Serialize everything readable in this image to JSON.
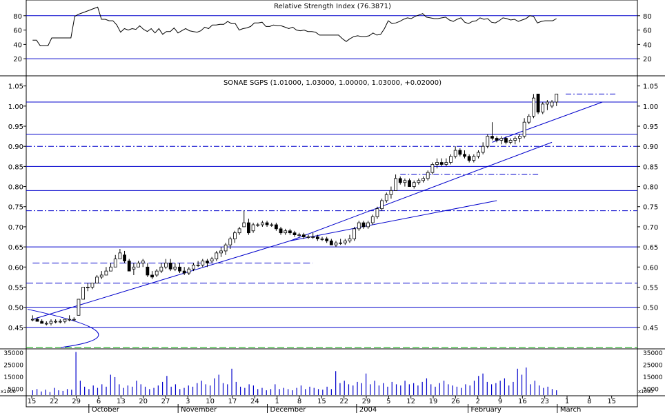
{
  "chart_data": [
    {
      "type": "line",
      "title": "Relative Strength Index (76.3871)",
      "ylim": [
        0,
        100
      ],
      "y_ticks": [
        "80",
        "60",
        "40",
        "20"
      ],
      "y_tick_values": [
        80,
        60,
        40,
        20
      ],
      "reference_lines": [
        80,
        20
      ],
      "series": [
        {
          "values": [
            46,
            46,
            38,
            38,
            38,
            49,
            49,
            49,
            49,
            49,
            49,
            79,
            82,
            84,
            86,
            88,
            90,
            92,
            75,
            75,
            73,
            73,
            67,
            57,
            62,
            60,
            62,
            61,
            66,
            61,
            58,
            62,
            56,
            62,
            54,
            58,
            58,
            63,
            56,
            59,
            62,
            59,
            58,
            57,
            59,
            64,
            62,
            67,
            67,
            68,
            68,
            72,
            69,
            69,
            60,
            62,
            63,
            65,
            70,
            70,
            71,
            65,
            65,
            67,
            66,
            66,
            64,
            62,
            64,
            60,
            59,
            60,
            58,
            58,
            57,
            53,
            53,
            53,
            53,
            53,
            53,
            48,
            44,
            48,
            51,
            52,
            51,
            51,
            52,
            56,
            53,
            54,
            62,
            73,
            69,
            70,
            72,
            75,
            77,
            76,
            79,
            81,
            83,
            78,
            77,
            76,
            76,
            77,
            78,
            74,
            72,
            75,
            77,
            71,
            69,
            72,
            73,
            77,
            75,
            76,
            71,
            70,
            73,
            77,
            76,
            74,
            75,
            72,
            74,
            76,
            80,
            79,
            70,
            72,
            73,
            73,
            73,
            76
          ]
        }
      ]
    },
    {
      "type": "line",
      "title": "SONAE SGPS (1.01000, 1.03000, 1.00000, 1.03000, +0.02000)",
      "ylim": [
        0.4,
        1.07
      ],
      "y_ticks": [
        "1.05",
        "1.00",
        "0.95",
        "0.90",
        "0.85",
        "0.80",
        "0.75",
        "0.70",
        "0.65",
        "0.60",
        "0.55",
        "0.50",
        "0.45"
      ],
      "y_tick_values": [
        1.05,
        1.0,
        0.95,
        0.9,
        0.85,
        0.8,
        0.75,
        0.7,
        0.65,
        0.6,
        0.55,
        0.5,
        0.45
      ],
      "horizontal_levels_solid": [
        1.01,
        0.93,
        0.85,
        0.79,
        0.65,
        0.5,
        0.45
      ],
      "horizontal_levels_dashdot": [
        0.9,
        0.74
      ],
      "horizontal_levels_dashed": [
        0.56
      ],
      "green_level": 0.4,
      "x_ticks": [
        "15",
        "22",
        "29",
        "6",
        "13",
        "20",
        "27",
        "3",
        "10",
        "17",
        "24",
        "1",
        "8",
        "15",
        "22",
        "29",
        "5",
        "12",
        "19",
        "26",
        "2",
        "9",
        "16",
        "23",
        "1",
        "8",
        "15"
      ],
      "month_labels": [
        "October",
        "November",
        "December",
        "2004",
        "February",
        "March"
      ],
      "candles": [
        [
          0.47,
          0.48,
          0.465,
          0.47
        ],
        [
          0.47,
          0.475,
          0.465,
          0.465
        ],
        [
          0.465,
          0.47,
          0.46,
          0.46
        ],
        [
          0.46,
          0.465,
          0.455,
          0.46
        ],
        [
          0.46,
          0.47,
          0.455,
          0.465
        ],
        [
          0.465,
          0.47,
          0.46,
          0.465
        ],
        [
          0.465,
          0.47,
          0.46,
          0.465
        ],
        [
          0.465,
          0.47,
          0.46,
          0.47
        ],
        [
          0.47,
          0.48,
          0.465,
          0.47
        ],
        [
          0.47,
          0.475,
          0.465,
          0.47
        ],
        [
          0.48,
          0.52,
          0.48,
          0.52
        ],
        [
          0.52,
          0.55,
          0.52,
          0.55
        ],
        [
          0.55,
          0.56,
          0.54,
          0.55
        ],
        [
          0.55,
          0.56,
          0.545,
          0.56
        ],
        [
          0.56,
          0.58,
          0.56,
          0.575
        ],
        [
          0.575,
          0.59,
          0.57,
          0.58
        ],
        [
          0.58,
          0.6,
          0.58,
          0.59
        ],
        [
          0.59,
          0.61,
          0.59,
          0.6
        ],
        [
          0.6,
          0.63,
          0.6,
          0.62
        ],
        [
          0.62,
          0.645,
          0.62,
          0.635
        ],
        [
          0.63,
          0.64,
          0.61,
          0.615
        ],
        [
          0.615,
          0.62,
          0.59,
          0.59
        ],
        [
          0.595,
          0.61,
          0.58,
          0.6
        ],
        [
          0.6,
          0.615,
          0.6,
          0.61
        ],
        [
          0.61,
          0.62,
          0.6,
          0.615
        ],
        [
          0.6,
          0.61,
          0.575,
          0.58
        ],
        [
          0.58,
          0.59,
          0.57,
          0.575
        ],
        [
          0.58,
          0.595,
          0.575,
          0.59
        ],
        [
          0.59,
          0.61,
          0.585,
          0.6
        ],
        [
          0.6,
          0.62,
          0.595,
          0.61
        ],
        [
          0.61,
          0.62,
          0.59,
          0.595
        ],
        [
          0.595,
          0.61,
          0.59,
          0.6
        ],
        [
          0.6,
          0.61,
          0.585,
          0.59
        ],
        [
          0.59,
          0.6,
          0.58,
          0.585
        ],
        [
          0.585,
          0.6,
          0.58,
          0.595
        ],
        [
          0.595,
          0.61,
          0.59,
          0.605
        ],
        [
          0.605,
          0.615,
          0.6,
          0.605
        ],
        [
          0.605,
          0.62,
          0.6,
          0.615
        ],
        [
          0.615,
          0.62,
          0.6,
          0.61
        ],
        [
          0.615,
          0.625,
          0.61,
          0.62
        ],
        [
          0.62,
          0.64,
          0.615,
          0.635
        ],
        [
          0.635,
          0.65,
          0.625,
          0.64
        ],
        [
          0.64,
          0.66,
          0.63,
          0.655
        ],
        [
          0.655,
          0.675,
          0.645,
          0.67
        ],
        [
          0.67,
          0.69,
          0.66,
          0.685
        ],
        [
          0.685,
          0.7,
          0.68,
          0.695
        ],
        [
          0.7,
          0.74,
          0.7,
          0.71
        ],
        [
          0.71,
          0.72,
          0.68,
          0.685
        ],
        [
          0.69,
          0.71,
          0.685,
          0.705
        ],
        [
          0.705,
          0.71,
          0.7,
          0.705
        ],
        [
          0.705,
          0.715,
          0.7,
          0.71
        ],
        [
          0.71,
          0.715,
          0.7,
          0.705
        ],
        [
          0.705,
          0.71,
          0.7,
          0.705
        ],
        [
          0.705,
          0.71,
          0.69,
          0.695
        ],
        [
          0.695,
          0.7,
          0.68,
          0.685
        ],
        [
          0.685,
          0.695,
          0.68,
          0.69
        ],
        [
          0.69,
          0.695,
          0.68,
          0.685
        ],
        [
          0.685,
          0.69,
          0.675,
          0.68
        ],
        [
          0.68,
          0.685,
          0.675,
          0.68
        ],
        [
          0.68,
          0.685,
          0.67,
          0.675
        ],
        [
          0.675,
          0.68,
          0.67,
          0.675
        ],
        [
          0.675,
          0.685,
          0.67,
          0.675
        ],
        [
          0.675,
          0.68,
          0.665,
          0.67
        ],
        [
          0.67,
          0.675,
          0.665,
          0.67
        ],
        [
          0.67,
          0.675,
          0.66,
          0.665
        ],
        [
          0.665,
          0.67,
          0.655,
          0.655
        ],
        [
          0.655,
          0.665,
          0.65,
          0.66
        ],
        [
          0.66,
          0.67,
          0.655,
          0.66
        ],
        [
          0.66,
          0.67,
          0.655,
          0.665
        ],
        [
          0.665,
          0.68,
          0.66,
          0.67
        ],
        [
          0.67,
          0.7,
          0.665,
          0.695
        ],
        [
          0.695,
          0.715,
          0.69,
          0.71
        ],
        [
          0.71,
          0.715,
          0.695,
          0.7
        ],
        [
          0.7,
          0.715,
          0.695,
          0.71
        ],
        [
          0.71,
          0.73,
          0.705,
          0.725
        ],
        [
          0.725,
          0.75,
          0.72,
          0.745
        ],
        [
          0.745,
          0.77,
          0.74,
          0.765
        ],
        [
          0.765,
          0.785,
          0.76,
          0.78
        ],
        [
          0.78,
          0.8,
          0.77,
          0.79
        ],
        [
          0.79,
          0.83,
          0.79,
          0.82
        ],
        [
          0.82,
          0.825,
          0.805,
          0.81
        ],
        [
          0.81,
          0.82,
          0.8,
          0.815
        ],
        [
          0.815,
          0.82,
          0.8,
          0.8
        ],
        [
          0.8,
          0.815,
          0.795,
          0.81
        ],
        [
          0.81,
          0.82,
          0.805,
          0.815
        ],
        [
          0.815,
          0.825,
          0.81,
          0.82
        ],
        [
          0.82,
          0.84,
          0.815,
          0.835
        ],
        [
          0.835,
          0.86,
          0.83,
          0.855
        ],
        [
          0.855,
          0.87,
          0.845,
          0.86
        ],
        [
          0.86,
          0.87,
          0.85,
          0.855
        ],
        [
          0.855,
          0.87,
          0.85,
          0.86
        ],
        [
          0.86,
          0.88,
          0.855,
          0.875
        ],
        [
          0.875,
          0.9,
          0.87,
          0.89
        ],
        [
          0.89,
          0.895,
          0.875,
          0.88
        ],
        [
          0.88,
          0.89,
          0.87,
          0.875
        ],
        [
          0.875,
          0.88,
          0.86,
          0.865
        ],
        [
          0.865,
          0.88,
          0.86,
          0.875
        ],
        [
          0.875,
          0.89,
          0.87,
          0.885
        ],
        [
          0.885,
          0.91,
          0.88,
          0.9
        ],
        [
          0.9,
          0.93,
          0.895,
          0.925
        ],
        [
          0.925,
          0.96,
          0.915,
          0.92
        ],
        [
          0.92,
          0.925,
          0.91,
          0.915
        ],
        [
          0.915,
          0.925,
          0.905,
          0.92
        ],
        [
          0.92,
          0.925,
          0.905,
          0.91
        ],
        [
          0.91,
          0.92,
          0.905,
          0.915
        ],
        [
          0.915,
          0.925,
          0.905,
          0.92
        ],
        [
          0.92,
          0.93,
          0.91,
          0.925
        ],
        [
          0.925,
          0.97,
          0.92,
          0.96
        ],
        [
          0.96,
          0.98,
          0.955,
          0.975
        ],
        [
          0.975,
          1.03,
          0.97,
          1.02
        ],
        [
          1.03,
          1.03,
          0.98,
          0.985
        ],
        [
          0.985,
          1.01,
          0.98,
          1.005
        ],
        [
          1.005,
          1.015,
          0.99,
          1.01
        ],
        [
          1.0,
          1.015,
          0.995,
          1.01
        ],
        [
          1.01,
          1.03,
          1.0,
          1.03
        ]
      ],
      "candle_x_start": 0,
      "trendlines": [
        {
          "from": [
            0,
            0.47
          ],
          "to": [
            56,
            0.665
          ]
        },
        {
          "from": [
            56,
            0.665
          ],
          "to": [
            113,
            0.91
          ]
        },
        {
          "from": [
            56,
            0.665
          ],
          "to": [
            101,
            0.765
          ]
        },
        {
          "from": [
            100,
            0.91
          ],
          "to": [
            124,
            1.01
          ]
        }
      ],
      "short_levels": [
        {
          "y": 0.83,
          "from": 80,
          "to": 110,
          "style": "dashdot"
        },
        {
          "y": 1.03,
          "from": 116,
          "to": 127,
          "style": "dashdot"
        },
        {
          "y": 0.61,
          "from": 0,
          "to": 61,
          "style": "dashed"
        }
      ]
    },
    {
      "type": "bar",
      "ylim": [
        0,
        38000
      ],
      "y_ticks": [
        "35000",
        "25000",
        "15000",
        "5000"
      ],
      "y_tick_values": [
        35000,
        25000,
        15000,
        5000
      ],
      "unit_label": "x1000",
      "values": [
        4000,
        5000,
        3000,
        4500,
        2500,
        6000,
        4000,
        3500,
        5000,
        4500,
        36000,
        12000,
        7000,
        5000,
        8000,
        6000,
        9000,
        7000,
        17000,
        15000,
        9000,
        6000,
        8000,
        7000,
        12000,
        9000,
        7000,
        5000,
        6000,
        8000,
        11000,
        16000,
        7000,
        9000,
        5000,
        6000,
        8000,
        7000,
        10000,
        12000,
        9000,
        8000,
        14000,
        17000,
        10000,
        9000,
        22000,
        11000,
        7000,
        6000,
        9000,
        8000,
        5000,
        6000,
        4000,
        5000,
        9000,
        5000,
        6000,
        5000,
        4000,
        6000,
        8000,
        5000,
        7000,
        6000,
        5000,
        4500,
        7000,
        5000,
        20000,
        10000,
        12000,
        9000,
        8000,
        11000,
        10000,
        18000,
        9000,
        12000,
        8000,
        10000,
        7000,
        11000,
        9000,
        8000,
        12000,
        9000,
        10000,
        8000,
        11000,
        14000,
        9000,
        7000,
        10000,
        12000,
        9000,
        8000,
        7000,
        6000,
        9000,
        8000,
        12000,
        16000,
        18000,
        11000,
        9000,
        10000,
        12000,
        14000,
        8000,
        11000,
        22000,
        17000,
        23000,
        9000,
        12000,
        8000,
        6000,
        7000,
        5000,
        4000
      ]
    }
  ]
}
